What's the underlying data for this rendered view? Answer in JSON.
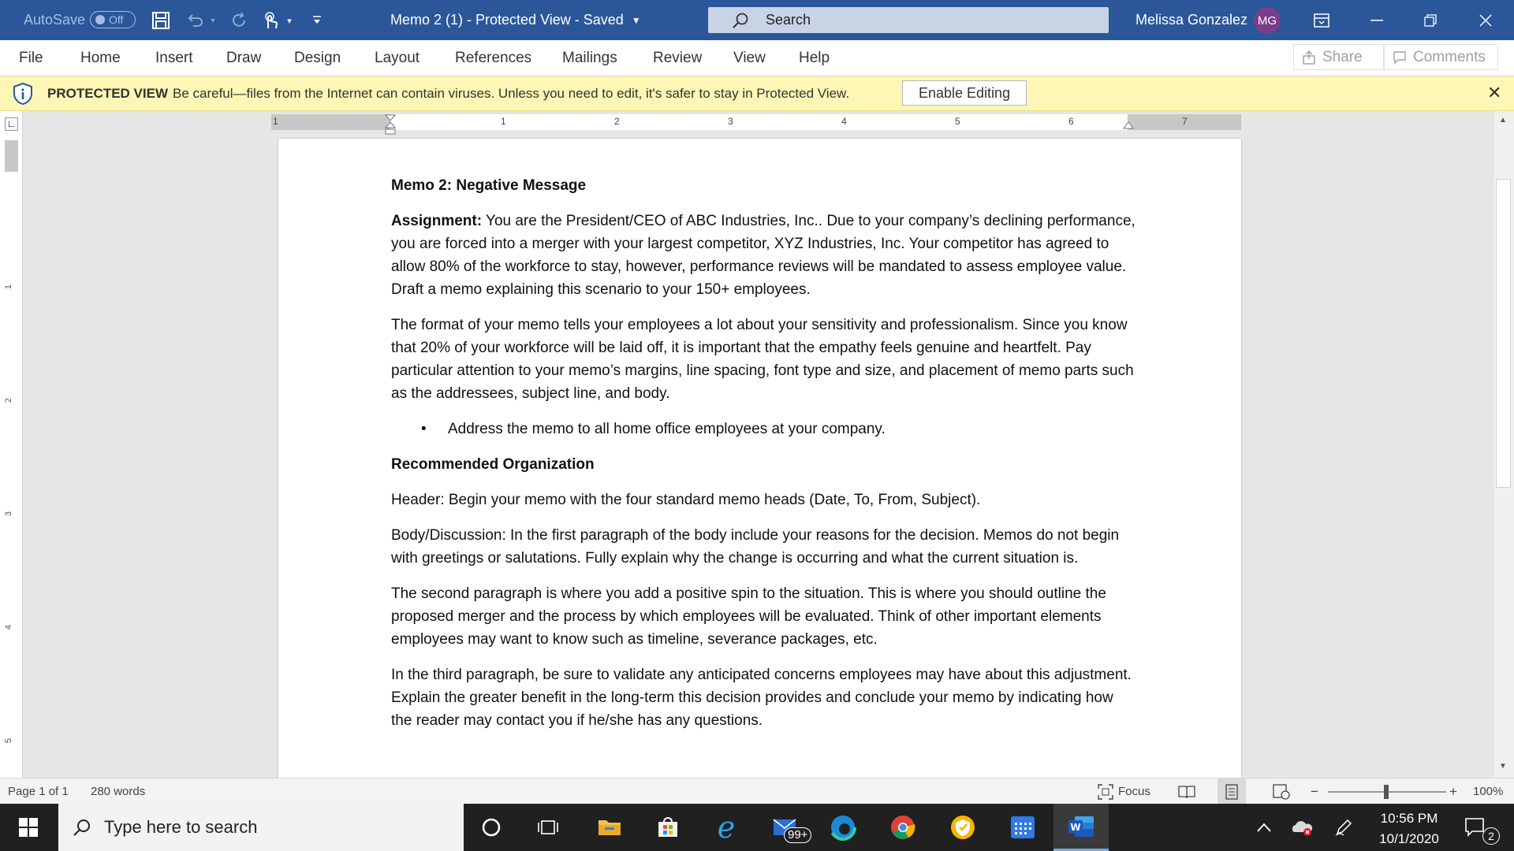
{
  "titlebar": {
    "autosave_label": "AutoSave",
    "autosave_state": "Off",
    "doc_title": "Memo 2 (1)  -  Protected View  -  Saved",
    "search_placeholder": "Search",
    "user_name": "Melissa Gonzalez",
    "user_initials": "MG"
  },
  "ribbon": {
    "tabs": [
      "File",
      "Home",
      "Insert",
      "Draw",
      "Design",
      "Layout",
      "References",
      "Mailings",
      "Review",
      "View",
      "Help"
    ],
    "share_label": "Share",
    "comments_label": "Comments"
  },
  "protected_view": {
    "title": "PROTECTED VIEW",
    "message": "Be careful—files from the Internet can contain viruses. Unless you need to edit, it's safer to stay in Protected View.",
    "enable_button": "Enable Editing"
  },
  "ruler": {
    "h_numbers": [
      "1",
      "1",
      "2",
      "3",
      "4",
      "5",
      "6",
      "7"
    ],
    "v_numbers": [
      "1",
      "2",
      "3",
      "4",
      "5"
    ]
  },
  "document": {
    "heading": "Memo 2: Negative Message",
    "assignment_label": "Assignment:",
    "assignment_text": " You are the President/CEO of ABC Industries, Inc..  Due to your company’s declining performance, you are forced into a merger with your largest competitor, XYZ Industries, Inc.  Your competitor has agreed to allow 80% of the workforce to stay, however, performance reviews will be mandated to assess employee value.  Draft a memo explaining this scenario to your 150+ employees.",
    "format_paragraph": "The format of your memo tells your employees a lot about your sensitivity and professionalism. Since you know that 20% of your workforce will be laid off, it is important that the empathy feels genuine and heartfelt.  Pay particular attention to your memo’s margins, line spacing, font type and size, and placement of memo parts such as the addressees, subject line, and body.",
    "bullet_char": "•",
    "bullet_text": "Address the memo to all home office employees at your company.",
    "org_heading": "Recommended Organization",
    "header_paragraph": "Header:  Begin your memo with the four standard memo heads (Date, To, From, Subject).",
    "body_paragraph": "Body/Discussion:   In the first paragraph of the body include your reasons for the decision.  Memos do not begin with greetings or salutations.  Fully explain why the change is occurring and what the current situation is.",
    "second_paragraph": "The second paragraph is where you add a positive spin to the situation.  This is where you should outline the proposed merger and the process by which employees will be evaluated.  Think of other important elements employees may want to know such as timeline, severance packages, etc.",
    "third_paragraph": "In the third paragraph, be sure to validate any anticipated concerns employees may have about this adjustment.  Explain the greater benefit in the long-term this decision provides and conclude your memo by indicating how the reader may contact you if he/she has any questions."
  },
  "statusbar": {
    "page_info": "Page 1 of 1",
    "word_count": "280 words",
    "focus_label": "Focus",
    "zoom_minus": "−",
    "zoom_plus": "+",
    "zoom_level": "100%"
  },
  "taskbar": {
    "search_placeholder": "Type here to search",
    "mail_badge": "99+",
    "time": "10:56 PM",
    "date": "10/1/2020",
    "notification_count": "2"
  },
  "colors": {
    "title_blue": "#2b579a",
    "protected_yellow": "#fdf6b5",
    "avatar_purple": "#7a3d8c",
    "word_blue": "#185abd"
  }
}
